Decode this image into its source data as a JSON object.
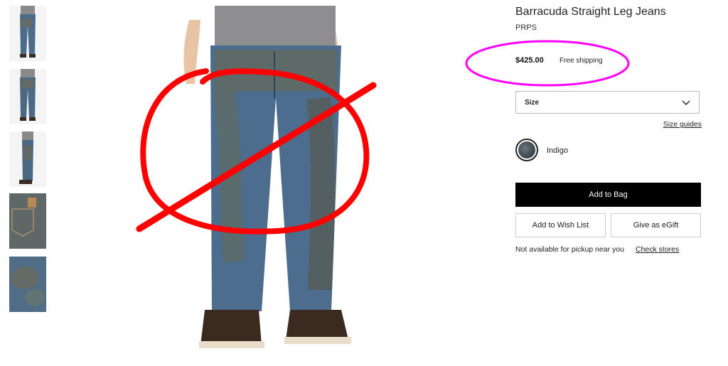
{
  "product": {
    "title": "Barracuda Straight Leg Jeans",
    "brand": "PRPS",
    "price": "$425.00",
    "shipping": "Free shipping"
  },
  "size": {
    "label": "Size",
    "guides": "Size guides"
  },
  "color": {
    "name": "Indigo",
    "swatch_hex": "#4a5559"
  },
  "actions": {
    "add_to_bag": "Add to Bag",
    "wish_list": "Add to Wish List",
    "egift": "Give as eGift"
  },
  "pickup": {
    "message": "Not available for pickup near you",
    "check_stores": "Check stores"
  },
  "thumbnails": [
    {
      "view": "front-full",
      "selected": true
    },
    {
      "view": "back-full",
      "selected": false
    },
    {
      "view": "side-full",
      "selected": false
    },
    {
      "view": "back-pocket-detail",
      "selected": false
    },
    {
      "view": "fabric-detail",
      "selected": false
    }
  ],
  "annotations": {
    "circle_color": "#ff00ff",
    "strike_color": "#ff0000"
  }
}
